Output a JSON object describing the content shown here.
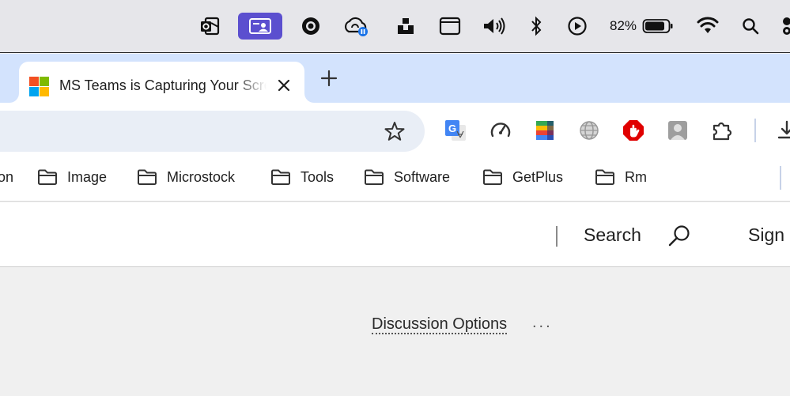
{
  "menubar": {
    "icons": [
      "outlook-icon",
      "screen-share-icon",
      "record-icon",
      "cloud-sync-icon",
      "unsplash-icon",
      "window-icon",
      "volume-icon",
      "bluetooth-icon",
      "play-icon",
      "battery-icon",
      "wifi-icon",
      "spotlight-search-icon",
      "control-center-icon"
    ],
    "battery_percent": "82%",
    "highlight_color": "#5b4fcf"
  },
  "tab": {
    "title": "MS Teams is Capturing Your Screen",
    "close_icon": "close-icon",
    "new_tab_icon": "plus-icon"
  },
  "toolbar": {
    "bookmark_icon": "star-icon",
    "extensions": [
      "google-translate-icon",
      "speedometer-icon",
      "google-workspace-icon",
      "globe-icon",
      "adblock-icon",
      "avatar-icon",
      "puzzle-extensions-icon",
      "download-icon"
    ]
  },
  "bookmarks": {
    "partial_left": "on",
    "items": [
      "Image",
      "Microstock",
      "Tools",
      "Software",
      "GetPlus",
      "Rm"
    ]
  },
  "header": {
    "search_label": "Search",
    "sign_label": "Sign"
  },
  "content": {
    "discussion_options": "Discussion Options",
    "more_label": "..."
  },
  "colors": {
    "tabstrip": "#d3e3fd",
    "omnibox": "#e9eef6",
    "page_bg": "#f0f0f0"
  }
}
